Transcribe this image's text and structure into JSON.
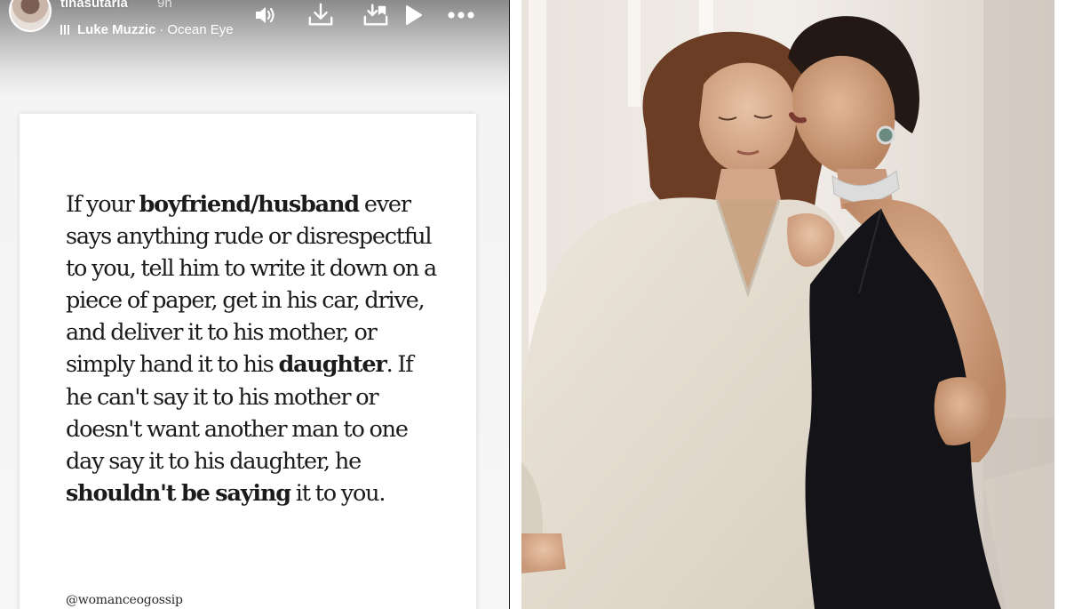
{
  "story": {
    "username": "tinasutaria",
    "time_ago": "9h",
    "music": {
      "artist": "Luke Muzzic",
      "separator": "·",
      "track": "Ocean Eyes"
    },
    "controls": [
      "speaker-icon",
      "download-icon",
      "save-to-collection-icon",
      "play-icon",
      "more-icon"
    ]
  },
  "quote": {
    "segments": [
      {
        "text": "If your ",
        "bold": false
      },
      {
        "text": "boyfriend/husband",
        "bold": true
      },
      {
        "text": " ever says anything rude or disrespectful to you, tell him to write it down on a piece of paper, get in his car, drive, and deliver it to his mother, or simply hand it to his ",
        "bold": false
      },
      {
        "text": "daughter",
        "bold": true
      },
      {
        "text": ". If he can't say it to his mother or doesn't want another man to one day say it to his daughter, he ",
        "bold": false
      },
      {
        "text": "shouldn't be saying",
        "bold": true
      },
      {
        "text": " it to you.",
        "bold": false
      }
    ],
    "handle": "@womanceogossip"
  },
  "colors": {
    "header_gradient_top": "#8a8a8a",
    "card_background": "#ffffff",
    "text": "#1b1b1b",
    "dress": "#141418",
    "blouse": "#e4dccf"
  }
}
